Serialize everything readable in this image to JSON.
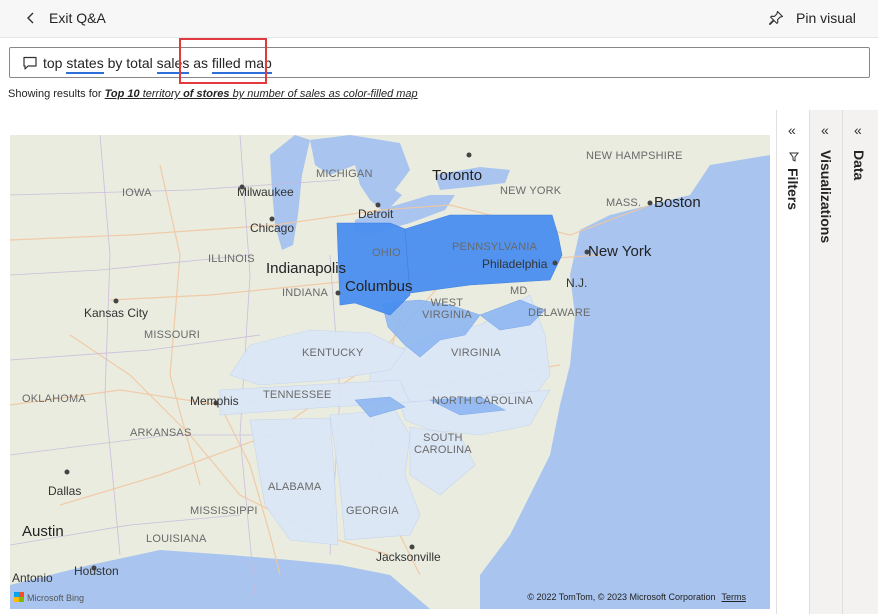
{
  "header": {
    "exit_label": "Exit Q&A",
    "pin_label": "Pin visual"
  },
  "question": {
    "words": [
      {
        "text": "top ",
        "term": false
      },
      {
        "text": "states",
        "term": true
      },
      {
        "text": " by total ",
        "term": false
      },
      {
        "text": "sales",
        "term": true
      },
      {
        "text": " as ",
        "term": false
      },
      {
        "text": "filled map",
        "term": true
      }
    ]
  },
  "results": {
    "prefix": "Showing results for",
    "link_part1": "Top 10",
    "link_part2": " territory ",
    "link_part3": "of stores",
    "link_part4": " by number of sales as color-filled map"
  },
  "map": {
    "labels": {
      "new_hampshire": "NEW HAMPSHIRE",
      "michigan": "MICHIGAN",
      "toronto": "Toronto",
      "iowa": "IOWA",
      "milwaukee": "Milwaukee",
      "new_york_state": "NEW YORK",
      "massachusetts": "MASS.",
      "boston": "Boston",
      "detroit": "Detroit",
      "chicago": "Chicago",
      "pennsylvania": "PENNSYLVANIA",
      "illinois": "ILLINOIS",
      "ohio": "OHIO",
      "philadelphia": "Philadelphia",
      "new_york_city": "New York",
      "indianapolis": "Indianapolis",
      "nj": "N.J.",
      "indiana": "INDIANA",
      "columbus": "Columbus",
      "md": "MD",
      "kansas_city": "Kansas City",
      "west_virginia": "WEST\nVIRGINIA",
      "delaware": "DELAWARE",
      "missouri": "MISSOURI",
      "kentucky": "KENTUCKY",
      "virginia": "VIRGINIA",
      "oklahoma": "OKLAHOMA",
      "memphis": "Memphis",
      "tennessee": "TENNESSEE",
      "north_carolina": "NORTH CAROLINA",
      "arkansas": "ARKANSAS",
      "south_carolina": "SOUTH\nCAROLINA",
      "dallas": "Dallas",
      "alabama": "ALABAMA",
      "mississippi": "MISSISSIPPI",
      "austin": "Austin",
      "georgia": "GEORGIA",
      "louisiana": "LOUISIANA",
      "jacksonville": "Jacksonville",
      "antonio": "Antonio",
      "houston": "Houston"
    },
    "bing_label": "Microsoft Bing",
    "copyright": "© 2022 TomTom, © 2023 Microsoft Corporation",
    "terms": "Terms"
  },
  "panes": {
    "filters": "Filters",
    "visualizations": "Visualizations",
    "data": "Data",
    "collapse_glyph": "«"
  },
  "colors": {
    "accent": "#2e6fd9",
    "highlight_box": "#e03a3e",
    "fill_high": "#4a8ff0",
    "fill_mid": "#8fb8f2",
    "fill_low": "#dbe7f7",
    "water": "#a8c4ef"
  }
}
